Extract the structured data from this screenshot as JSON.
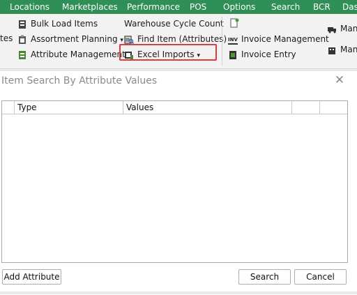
{
  "menubar": {
    "items": [
      "Locations",
      "Marketplaces",
      "Performance",
      "POS",
      "Options",
      "Search",
      "BCR",
      "Das"
    ]
  },
  "ribbon": {
    "col0": {
      "partial_label": "tes"
    },
    "col1": {
      "bulk_load": "Bulk Load Items",
      "assortment": "Assortment Planning",
      "attribute_mgmt": "Attribute Management"
    },
    "col2": {
      "warehouse": "Warehouse Cycle Count",
      "find_item": "Find Item (Attributes)",
      "excel_imports": "Excel Imports"
    },
    "col3": {
      "invoice_mgmt": "Invoice Management",
      "invoice_entry": "Invoice Entry"
    },
    "col4": {
      "item1": "Man",
      "item2": "Man"
    },
    "dropdown_glyph": "▾"
  },
  "dialog": {
    "title": "Item Search By Attribute Values",
    "close_glyph": "✕",
    "grid": {
      "headers": [
        "",
        "Type",
        "Values",
        "",
        ""
      ],
      "rows": []
    },
    "buttons": {
      "add_attribute": "Add Attribute",
      "search": "Search",
      "cancel": "Cancel"
    }
  },
  "colors": {
    "menubar_bg": "#2f8f57",
    "highlight_border": "#e23b3b"
  }
}
